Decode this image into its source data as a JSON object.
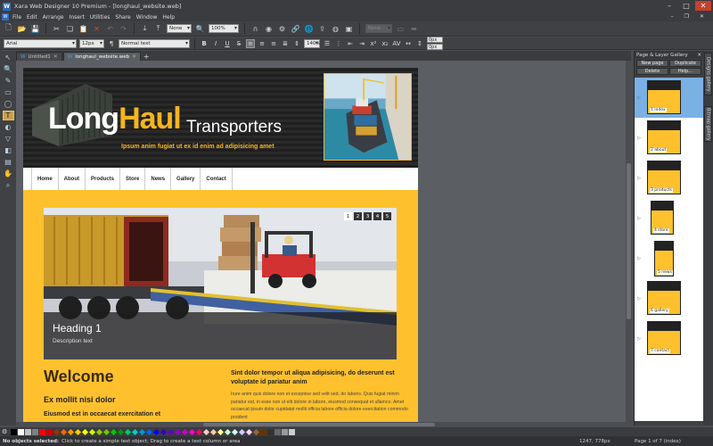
{
  "window": {
    "title": "Xara Web Designer 10 Premium - [longhaul_website.web]",
    "app_icon": "W"
  },
  "menu": {
    "items": [
      "File",
      "Edit",
      "Arrange",
      "Insert",
      "Utilities",
      "Share",
      "Window",
      "Help"
    ]
  },
  "toolbar": {
    "zoom_value": "100%",
    "blend_value": "None",
    "transparency_value": "None",
    "font_family": "Arial",
    "font_size": "12px",
    "text_style": "Normal text",
    "line_spacing": "140%",
    "space_before": "0px",
    "space_after": "0px"
  },
  "tabs": [
    {
      "label": "Untitled1",
      "active": false
    },
    {
      "label": "longhaul_website.web",
      "active": true
    }
  ],
  "site": {
    "brand_long": "Long",
    "brand_haul": "Haul",
    "brand_sub": "Transporters",
    "tagline": "Ipsum anim fugiat ut ex id enim ad adipisicing amet",
    "nav": [
      "Home",
      "About",
      "Products",
      "Store",
      "News",
      "Gallery",
      "Contact"
    ],
    "slider": {
      "heading": "Heading 1",
      "description": "Description text",
      "pages": [
        "1",
        "2",
        "3",
        "4",
        "5"
      ],
      "active_page": 1
    },
    "welcome": "Welcome",
    "welcome_sub": "Ex mollit nisi dolor",
    "welcome_sub2": "Eiusmod est in occaecat exercitation et",
    "right_heading": "Sint dolor tempor ut aliqua adipisicing, do deserunt est voluptate id pariatur anim",
    "right_body": "Irure anim quis dolore non et excepteur sed velit sed, do laboris. Quis fugiat minim pariatur est, in esse non ut elit dolore in labore, eiusmod consequat et ullamco. Amet occaecat ipsum dolor cupidatat mollit officia labore officia dolore exercitation commodo proident"
  },
  "gallery": {
    "title": "Page & Layer Gallery",
    "buttons": [
      "New page",
      "Duplicate",
      "Delete",
      "Help..."
    ],
    "pages": [
      "1 index",
      "2 about",
      "3 products",
      "4 store",
      "5 news",
      "6 gallery",
      "7 contact"
    ],
    "selected": 0,
    "side_tabs": [
      "Designs gallery",
      "Bitmap gallery"
    ]
  },
  "status": {
    "main": "No objects selected:",
    "hint": "Click to create a simple text object; Drag to create a text column or area",
    "coords": "1247, 778px",
    "page": "Page 1 of 7 (index)"
  },
  "palette": [
    "#000000",
    "#ffffff",
    "#c0c0c0",
    "#808080",
    "#ff0000",
    "#cc0000",
    "#993300",
    "#ff6600",
    "#ff9900",
    "#ffcc00",
    "#ffff00",
    "#ccff00",
    "#99cc00",
    "#66cc00",
    "#00cc00",
    "#009900",
    "#00cc66",
    "#00cccc",
    "#0099cc",
    "#0066ff",
    "#0000ff",
    "#3300cc",
    "#6600cc",
    "#9900cc",
    "#cc00cc",
    "#ff00cc",
    "#ff0066",
    "#ffcccc",
    "#ffcc99",
    "#ffff99",
    "#ccffcc",
    "#ccffff",
    "#ccccff",
    "#ffccff",
    "#996633",
    "#663300",
    "#333333",
    "#666666",
    "#999999",
    "#cccccc"
  ]
}
